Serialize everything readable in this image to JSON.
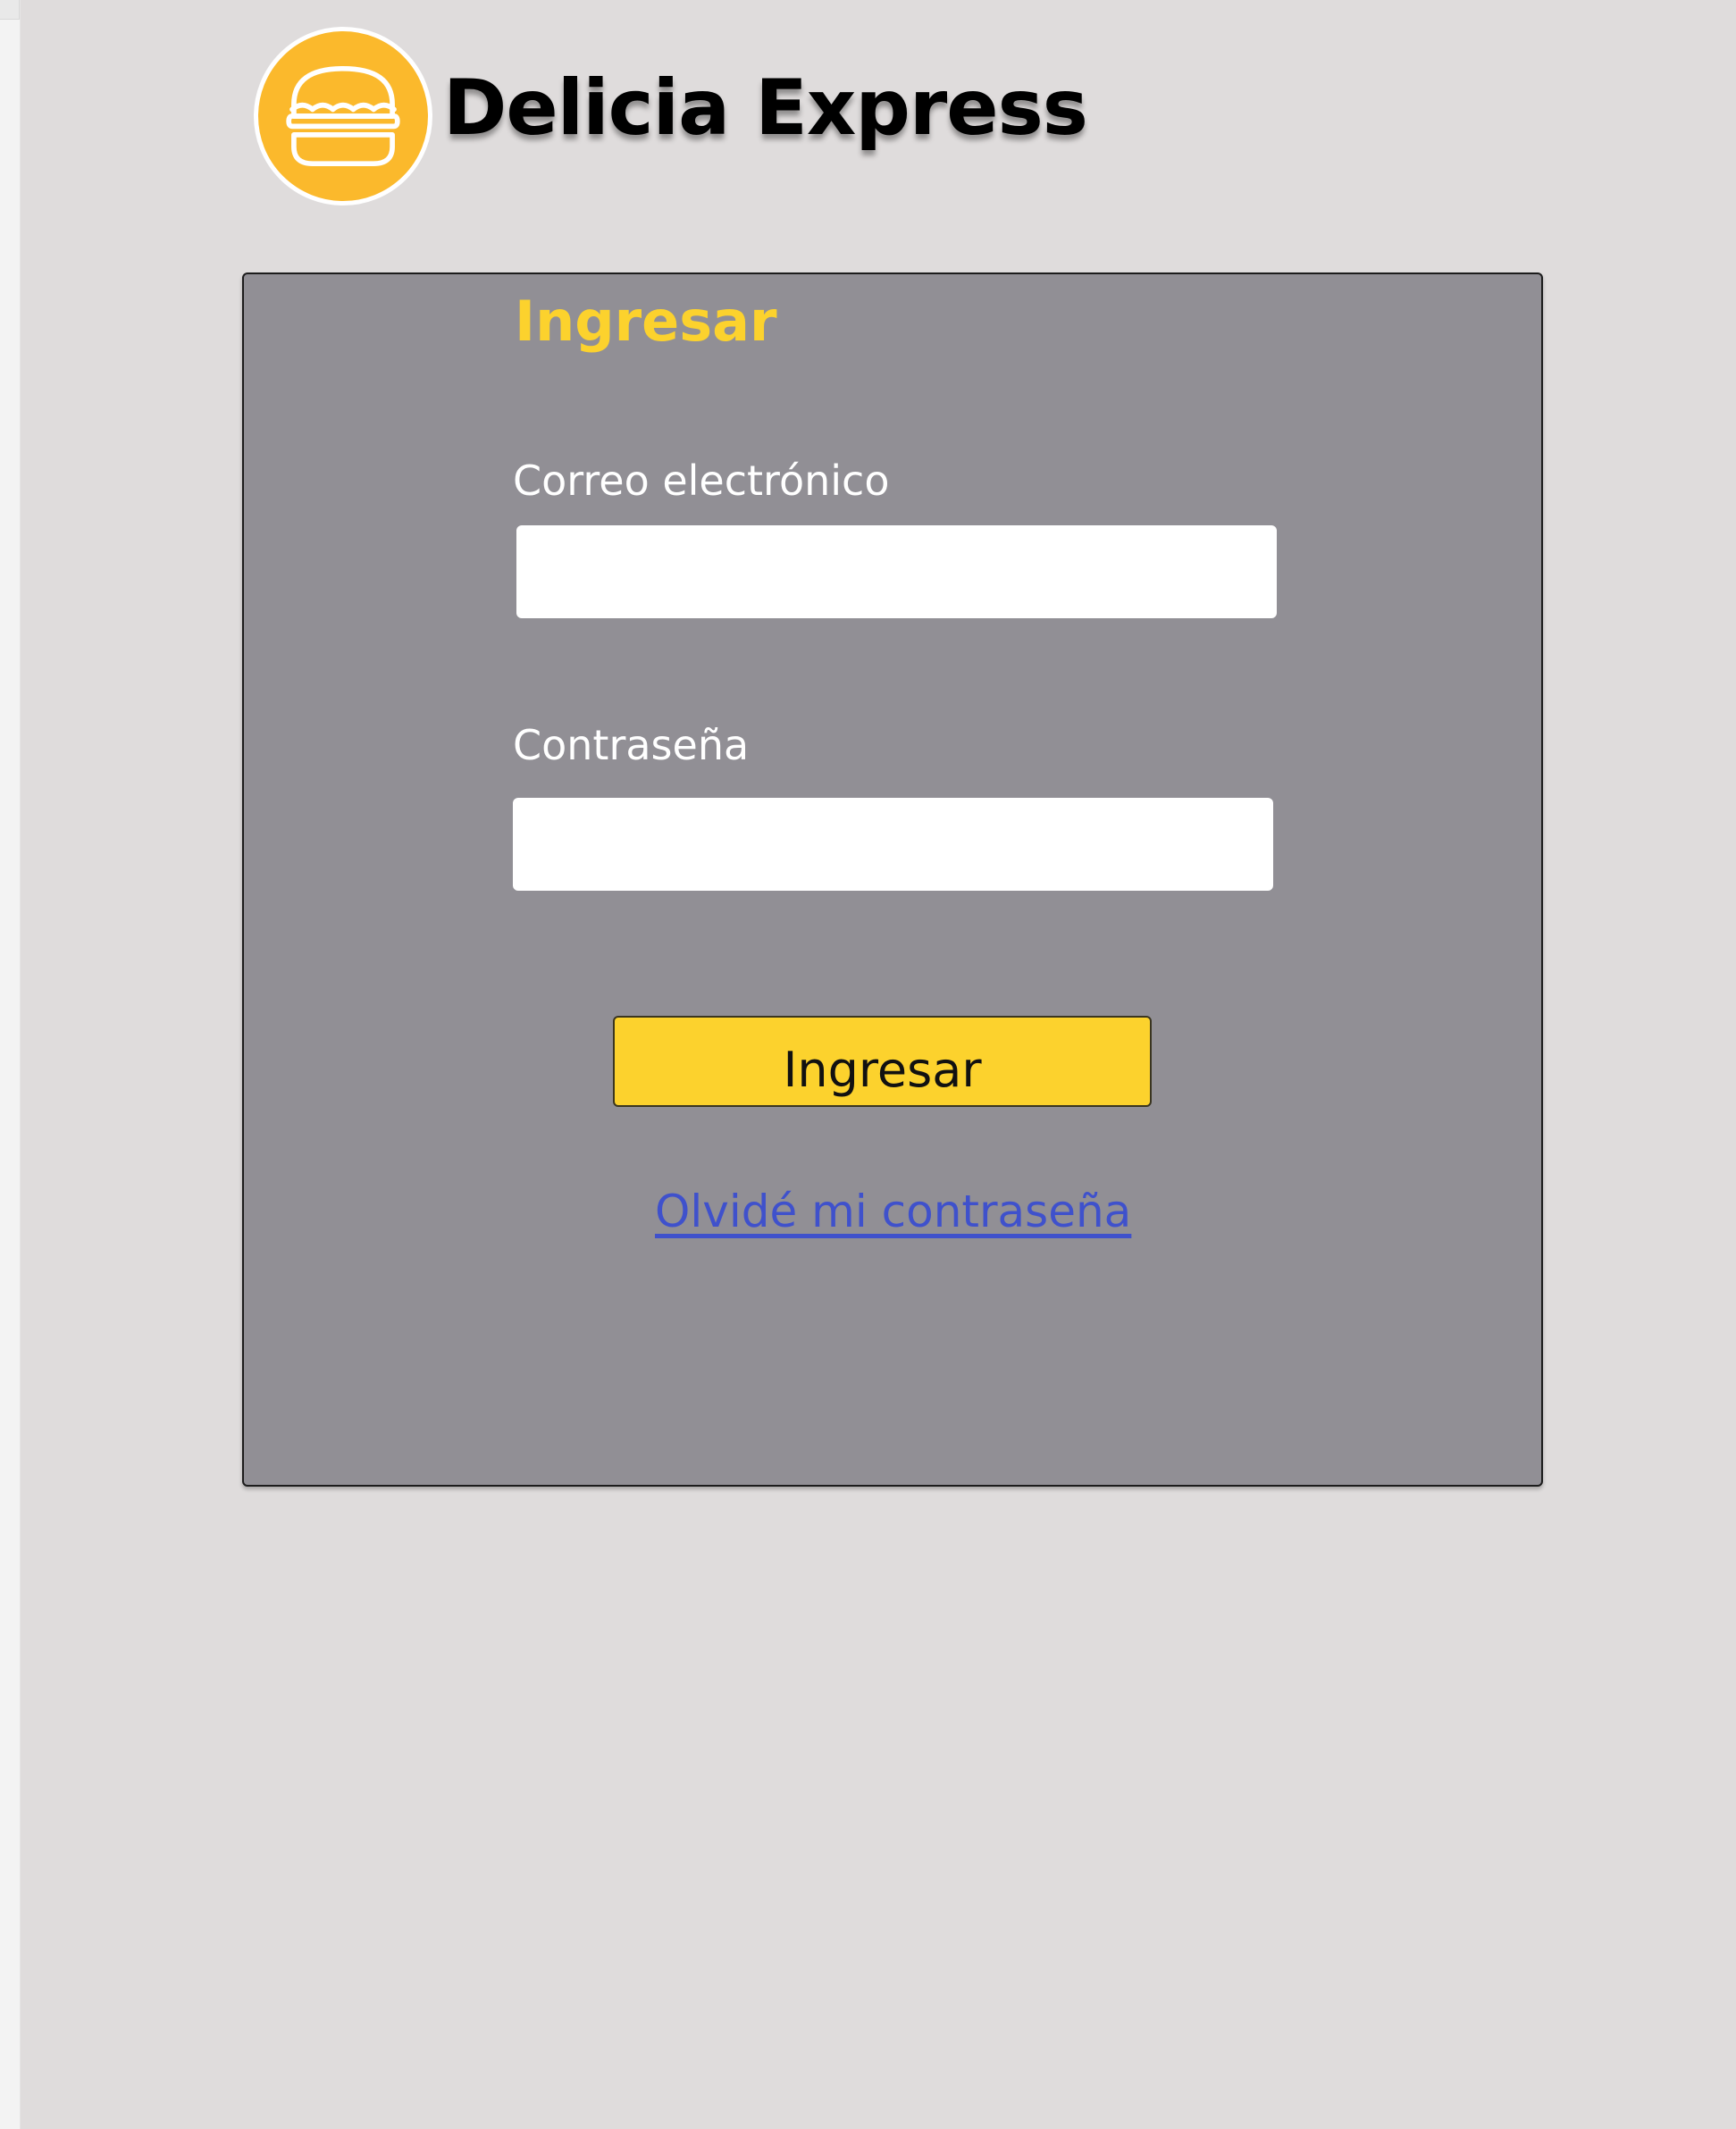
{
  "header": {
    "logo_icon": "burger-icon",
    "brand_name": "Delicia Express"
  },
  "login": {
    "title": "Ingresar",
    "email_label": "Correo electrónico",
    "email_value": "",
    "password_label": "Contraseña",
    "password_value": "",
    "submit_label": "Ingresar",
    "forgot_link": "Olvidé mi contraseña"
  },
  "colors": {
    "page_background": "#dfdcdc",
    "card_background": "#918f95",
    "accent_yellow": "#fcd22d",
    "logo_orange": "#fbb92c",
    "link_blue": "#3f51cc"
  }
}
